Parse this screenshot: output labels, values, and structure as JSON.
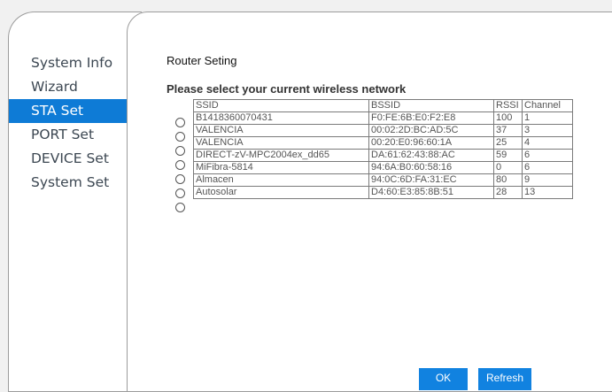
{
  "nav": {
    "items": [
      "System Info",
      "Wizard",
      "STA Set",
      "PORT Set",
      "DEVICE Set",
      "System Set"
    ],
    "active_index": 2
  },
  "page": {
    "title": "Router Seting",
    "subtitle": "Please select your current wireless network"
  },
  "table": {
    "headers": [
      "SSID",
      "BSSID",
      "RSSI",
      "Channel"
    ],
    "rows": [
      [
        "B1418360070431",
        "F0:FE:6B:E0:F2:E8",
        "100",
        "1"
      ],
      [
        "VALENCIA",
        "00:02:2D:BC:AD:5C",
        "37",
        "3"
      ],
      [
        "VALENCIA",
        "00:20:E0:96:60:1A",
        "25",
        "4"
      ],
      [
        "DIRECT-zV-MPC2004ex_dd65",
        "DA:61:62:43:88:AC",
        "59",
        "6"
      ],
      [
        "MiFibra-5814",
        "94:6A:B0:60:58:16",
        "0",
        "6"
      ],
      [
        "Almacen",
        "94:0C:6D:FA:31:EC",
        "80",
        "9"
      ],
      [
        "Autosolar",
        "D4:60:E3:85:8B:51",
        "28",
        "13"
      ]
    ]
  },
  "buttons": {
    "ok": "OK",
    "refresh": "Refresh"
  },
  "colors": {
    "accent": "#0e7bd6",
    "button": "#1182e0",
    "sidebar_text": "#3c4752"
  }
}
